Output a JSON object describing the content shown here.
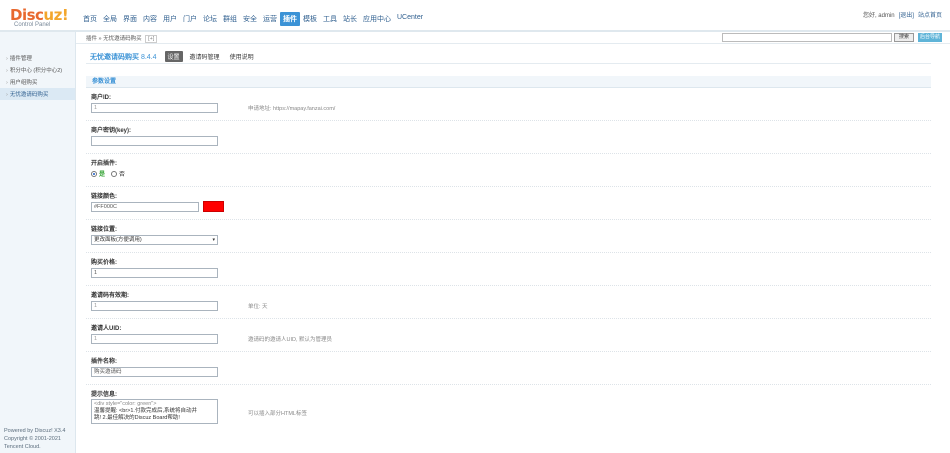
{
  "header": {
    "brand_main": "Disc",
    "brand_accent": "uz!",
    "brand_sub": "Control Panel",
    "nav": [
      "首页",
      "全局",
      "界面",
      "内容",
      "用户",
      "门户",
      "论坛",
      "群组",
      "安全",
      "运营",
      "插件",
      "模板",
      "工具",
      "站长",
      "应用中心",
      "UCenter"
    ],
    "active_nav": "插件",
    "greeting": "您好, admin",
    "logout": "[退出]",
    "site_home": "站点首页"
  },
  "breadcrumb": {
    "text": "插件 » 无忧邀请码购买",
    "add": "[+]",
    "search_button": "搜索",
    "admin_button": "后台导航"
  },
  "sidebar": {
    "items": [
      "插件管理",
      "积分中心 (积分中心2)",
      "用户组购买",
      "无忧邀请码购买"
    ],
    "active_index": 3,
    "footer": [
      "Powered by Discuz! X3.4",
      "Copyright © 2001-2021",
      "Tencent Cloud."
    ]
  },
  "page": {
    "title": "无忧邀请码购买",
    "version": "8.4.4",
    "tabs": [
      "设置",
      "邀请码管理",
      "使用说明"
    ],
    "active_tab": "设置",
    "section_title": "参数设置"
  },
  "fields": {
    "merchant_id": {
      "label": "商户ID:",
      "value": "1",
      "hint": "申请地址: https://mapay.fanzai.com/"
    },
    "merchant_key": {
      "label": "商户密钥(key):",
      "value": ""
    },
    "enable_plugin": {
      "label": "开启插件:",
      "yes": "是",
      "no": "否",
      "selected": "是"
    },
    "link_color": {
      "label": "链接颜色:",
      "value": "#FF000C",
      "swatch": "#ff0000"
    },
    "link_position": {
      "label": "链接位置:",
      "value": "更改面板(方便调用)"
    },
    "purchase_price": {
      "label": "购买价格:",
      "value": "1"
    },
    "code_validity": {
      "label": "邀请码有效期:",
      "value": "1",
      "hint": "单位: 天"
    },
    "inviter_uid": {
      "label": "邀请人UID:",
      "value": "1",
      "hint": "邀请码的邀请人UID, 默认为管理员"
    },
    "plugin_name": {
      "label": "插件名称:",
      "value": "购买邀请码"
    },
    "display_info": {
      "label": "提示信息:",
      "line1": "<div style=\"color: green\">",
      "line2": "温馨提醒: <br>1.付款完成后,系统将自动并",
      "line3": "跳! 2.最佳解决的Discuz Board帮助!",
      "hint": "可以插入部分HTML标签"
    }
  }
}
